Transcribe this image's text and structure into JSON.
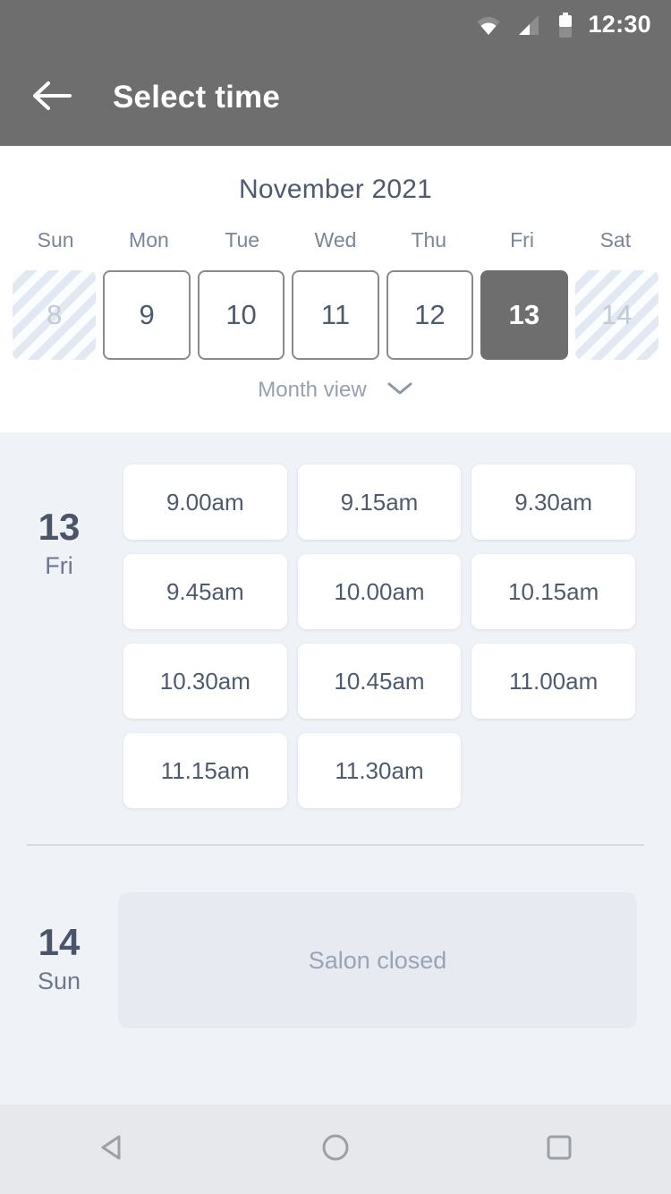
{
  "status_bar": {
    "time": "12:30",
    "icons": [
      "wifi-icon",
      "signal-icon",
      "battery-icon"
    ]
  },
  "app_bar": {
    "back_icon": "arrow-left-icon",
    "title": "Select time"
  },
  "calendar": {
    "month_title": "November 2021",
    "day_headers": [
      "Sun",
      "Mon",
      "Tue",
      "Wed",
      "Thu",
      "Fri",
      "Sat"
    ],
    "days": [
      {
        "num": "8",
        "state": "disabled"
      },
      {
        "num": "9",
        "state": "enabled"
      },
      {
        "num": "10",
        "state": "enabled"
      },
      {
        "num": "11",
        "state": "enabled"
      },
      {
        "num": "12",
        "state": "enabled"
      },
      {
        "num": "13",
        "state": "selected"
      },
      {
        "num": "14",
        "state": "disabled"
      }
    ],
    "view_toggle_label": "Month view",
    "view_toggle_icon": "chevron-down-icon"
  },
  "schedule": [
    {
      "day_num": "13",
      "day_name": "Fri",
      "slots": [
        "9.00am",
        "9.15am",
        "9.30am",
        "9.45am",
        "10.00am",
        "10.15am",
        "10.30am",
        "10.45am",
        "11.00am",
        "11.15am",
        "11.30am"
      ]
    },
    {
      "day_num": "14",
      "day_name": "Sun",
      "closed_message": "Salon closed"
    }
  ],
  "nav_bar": {
    "back_label": "back-triangle-icon",
    "home_label": "home-circle-icon",
    "recents_label": "recents-square-icon"
  },
  "colors": {
    "chrome": "#6E6E6E",
    "page_bg": "#EFF2F7",
    "card_bg": "#FFFFFF",
    "text_primary": "#4E5A6E",
    "text_muted": "#96A0B0",
    "selected_day_bg": "#6E6E6E",
    "closed_box_bg": "#E7EBF1",
    "navbar_bg": "#E6E8EB"
  }
}
